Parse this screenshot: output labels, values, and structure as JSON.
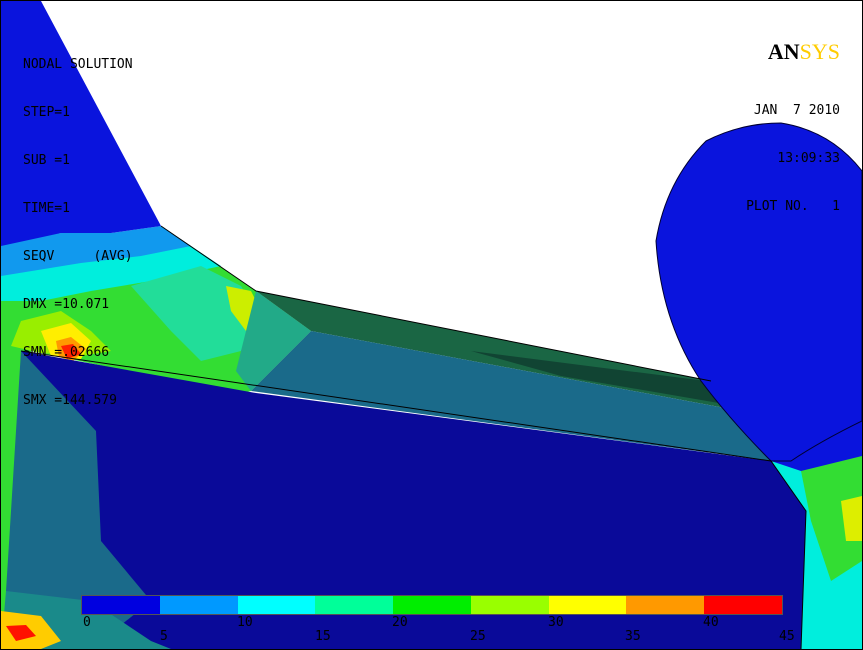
{
  "header": {
    "logo_main": "AN",
    "logo_sub": "SYS",
    "date": "JAN  7 2010",
    "time": "13:09:33",
    "plot_no": "PLOT NO.   1"
  },
  "info": {
    "title": "NODAL SOLUTION",
    "lines": [
      "STEP=1",
      "SUB =1",
      "TIME=1",
      "SEQV     (AVG)",
      "DMX =10.071",
      "SMN =.02666",
      "SMX =144.579"
    ]
  },
  "legend": {
    "colors": [
      "#0000e0",
      "#0099ff",
      "#00ffff",
      "#00ff99",
      "#00ee00",
      "#99ff00",
      "#ffff00",
      "#ff9900",
      "#ff0000"
    ],
    "labels_top": [
      "0",
      "10",
      "20",
      "30",
      "40"
    ],
    "labels_bottom": [
      "5",
      "15",
      "25",
      "35",
      "45"
    ]
  }
}
